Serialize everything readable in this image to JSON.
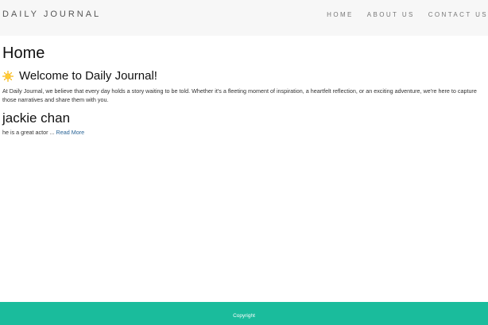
{
  "navbar": {
    "brand": "DAILY JOURNAL",
    "links": [
      "HOME",
      "ABOUT US",
      "CONTACT US"
    ]
  },
  "main": {
    "title": "Home",
    "welcome_heading": "Welcome to Daily Journal!",
    "welcome_icon": "sun-icon",
    "intro_text": "At Daily Journal, we believe that every day holds a story waiting to be told. Whether it's a fleeting moment of inspiration, a heartfelt reflection, or an exciting adventure, we're here to capture those narratives and share them with you.",
    "posts": [
      {
        "title": "jackie chan",
        "excerpt": "he is a great actor ...",
        "read_more": "Read More"
      }
    ]
  },
  "footer": {
    "copyright": "Copyright"
  },
  "colors": {
    "footer_bg": "#1abc9c",
    "navbar_bg": "#f7f7f7",
    "link": "#2a6496"
  }
}
